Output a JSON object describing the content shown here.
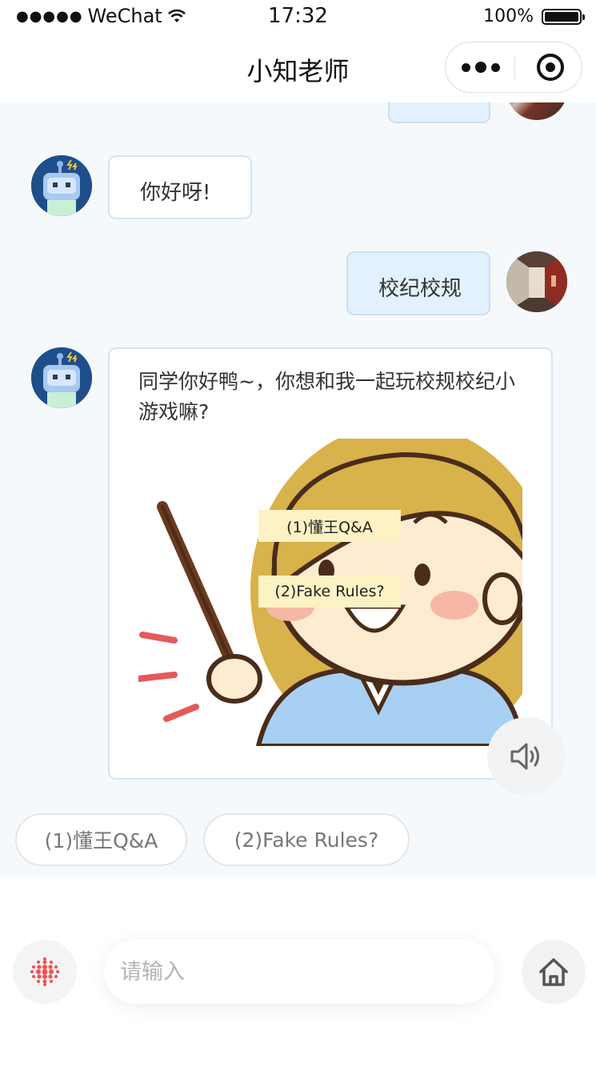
{
  "status_bar": {
    "carrier": "WeChat",
    "time": "17:32",
    "battery": "100%"
  },
  "nav": {
    "title": "小知老师"
  },
  "messages": [
    {
      "role": "bot",
      "text": "你好呀!"
    },
    {
      "role": "user",
      "text": "校纪校规"
    },
    {
      "role": "bot",
      "text": "同学你好鸭~，你想和我一起玩校规校纪小游戏嘛?"
    }
  ],
  "image_buttons": [
    "(1)懂王Q&A",
    "(2)Fake Rules?"
  ],
  "quick_replies": [
    "(1)懂王Q&A",
    "(2)Fake Rules?"
  ],
  "input": {
    "placeholder": "请输入",
    "value": ""
  },
  "icons": {
    "more": "more-dots-icon",
    "close": "target-circle-icon",
    "speaker": "speaker-icon",
    "voice": "voice-dots-icon",
    "home": "home-icon"
  },
  "colors": {
    "chat_background": "#f5f9fb",
    "user_bubble": "#e3f0fe",
    "bot_bubble_border": "#d4e4f5",
    "mic_accent": "#f05050"
  }
}
